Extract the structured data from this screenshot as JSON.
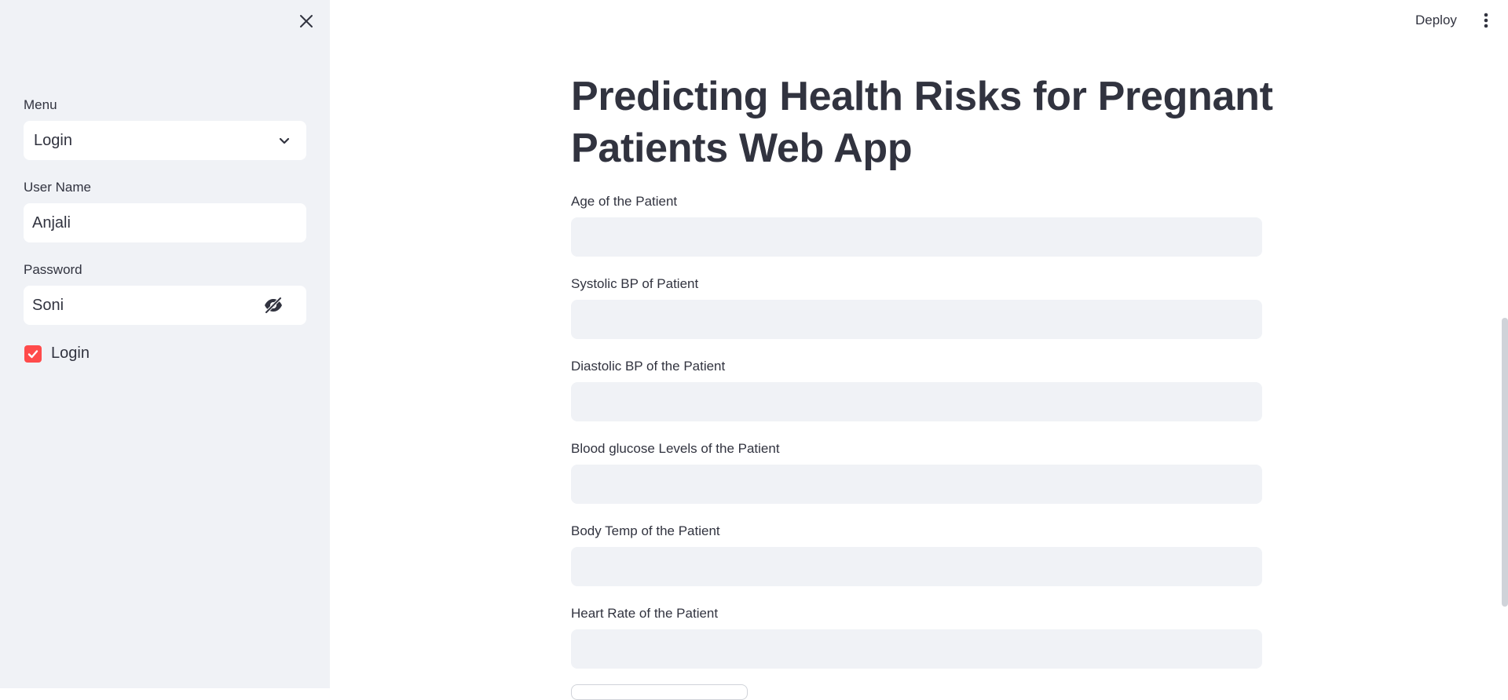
{
  "sidebar": {
    "menu_label": "Menu",
    "menu_selected": "Login",
    "username_label": "User Name",
    "username_value": "Anjali",
    "password_label": "Password",
    "password_value": "Soni",
    "login_checkbox_label": "Login",
    "login_checked": true
  },
  "header": {
    "deploy_label": "Deploy"
  },
  "main": {
    "title": "Predicting Health Risks for Pregnant Patients Web App",
    "fields": [
      {
        "label": "Age of the Patient",
        "value": ""
      },
      {
        "label": "Systolic BP of Patient",
        "value": ""
      },
      {
        "label": "Diastolic BP of the Patient",
        "value": ""
      },
      {
        "label": "Blood glucose Levels of the Patient",
        "value": ""
      },
      {
        "label": "Body Temp of the Patient",
        "value": ""
      },
      {
        "label": "Heart Rate of the Patient",
        "value": ""
      }
    ]
  },
  "colors": {
    "accent": "#ff4b4b",
    "sidebar_bg": "#f0f2f6",
    "input_bg": "#f0f2f6",
    "text": "#31333f"
  },
  "icons": {
    "close": "close-icon",
    "chevron": "chevron-down-icon",
    "eye": "eye-slash-icon",
    "check": "check-icon",
    "menu": "more-vertical-icon"
  }
}
